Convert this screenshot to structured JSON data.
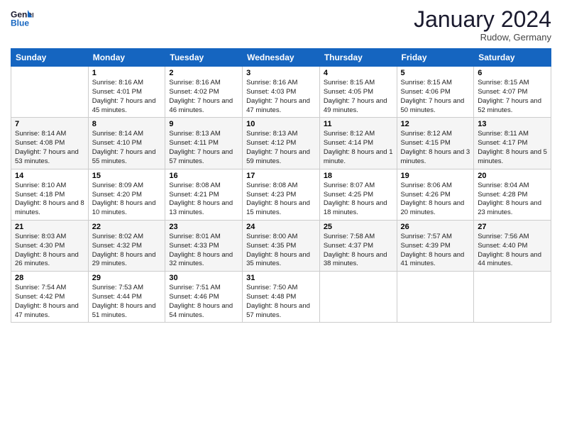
{
  "logo": {
    "line1": "General",
    "line2": "Blue"
  },
  "title": "January 2024",
  "subtitle": "Rudow, Germany",
  "days_header": [
    "Sunday",
    "Monday",
    "Tuesday",
    "Wednesday",
    "Thursday",
    "Friday",
    "Saturday"
  ],
  "weeks": [
    [
      {
        "day": "",
        "sunrise": "",
        "sunset": "",
        "daylight": ""
      },
      {
        "day": "1",
        "sunrise": "Sunrise: 8:16 AM",
        "sunset": "Sunset: 4:01 PM",
        "daylight": "Daylight: 7 hours and 45 minutes."
      },
      {
        "day": "2",
        "sunrise": "Sunrise: 8:16 AM",
        "sunset": "Sunset: 4:02 PM",
        "daylight": "Daylight: 7 hours and 46 minutes."
      },
      {
        "day": "3",
        "sunrise": "Sunrise: 8:16 AM",
        "sunset": "Sunset: 4:03 PM",
        "daylight": "Daylight: 7 hours and 47 minutes."
      },
      {
        "day": "4",
        "sunrise": "Sunrise: 8:15 AM",
        "sunset": "Sunset: 4:05 PM",
        "daylight": "Daylight: 7 hours and 49 minutes."
      },
      {
        "day": "5",
        "sunrise": "Sunrise: 8:15 AM",
        "sunset": "Sunset: 4:06 PM",
        "daylight": "Daylight: 7 hours and 50 minutes."
      },
      {
        "day": "6",
        "sunrise": "Sunrise: 8:15 AM",
        "sunset": "Sunset: 4:07 PM",
        "daylight": "Daylight: 7 hours and 52 minutes."
      }
    ],
    [
      {
        "day": "7",
        "sunrise": "Sunrise: 8:14 AM",
        "sunset": "Sunset: 4:08 PM",
        "daylight": "Daylight: 7 hours and 53 minutes."
      },
      {
        "day": "8",
        "sunrise": "Sunrise: 8:14 AM",
        "sunset": "Sunset: 4:10 PM",
        "daylight": "Daylight: 7 hours and 55 minutes."
      },
      {
        "day": "9",
        "sunrise": "Sunrise: 8:13 AM",
        "sunset": "Sunset: 4:11 PM",
        "daylight": "Daylight: 7 hours and 57 minutes."
      },
      {
        "day": "10",
        "sunrise": "Sunrise: 8:13 AM",
        "sunset": "Sunset: 4:12 PM",
        "daylight": "Daylight: 7 hours and 59 minutes."
      },
      {
        "day": "11",
        "sunrise": "Sunrise: 8:12 AM",
        "sunset": "Sunset: 4:14 PM",
        "daylight": "Daylight: 8 hours and 1 minute."
      },
      {
        "day": "12",
        "sunrise": "Sunrise: 8:12 AM",
        "sunset": "Sunset: 4:15 PM",
        "daylight": "Daylight: 8 hours and 3 minutes."
      },
      {
        "day": "13",
        "sunrise": "Sunrise: 8:11 AM",
        "sunset": "Sunset: 4:17 PM",
        "daylight": "Daylight: 8 hours and 5 minutes."
      }
    ],
    [
      {
        "day": "14",
        "sunrise": "Sunrise: 8:10 AM",
        "sunset": "Sunset: 4:18 PM",
        "daylight": "Daylight: 8 hours and 8 minutes."
      },
      {
        "day": "15",
        "sunrise": "Sunrise: 8:09 AM",
        "sunset": "Sunset: 4:20 PM",
        "daylight": "Daylight: 8 hours and 10 minutes."
      },
      {
        "day": "16",
        "sunrise": "Sunrise: 8:08 AM",
        "sunset": "Sunset: 4:21 PM",
        "daylight": "Daylight: 8 hours and 13 minutes."
      },
      {
        "day": "17",
        "sunrise": "Sunrise: 8:08 AM",
        "sunset": "Sunset: 4:23 PM",
        "daylight": "Daylight: 8 hours and 15 minutes."
      },
      {
        "day": "18",
        "sunrise": "Sunrise: 8:07 AM",
        "sunset": "Sunset: 4:25 PM",
        "daylight": "Daylight: 8 hours and 18 minutes."
      },
      {
        "day": "19",
        "sunrise": "Sunrise: 8:06 AM",
        "sunset": "Sunset: 4:26 PM",
        "daylight": "Daylight: 8 hours and 20 minutes."
      },
      {
        "day": "20",
        "sunrise": "Sunrise: 8:04 AM",
        "sunset": "Sunset: 4:28 PM",
        "daylight": "Daylight: 8 hours and 23 minutes."
      }
    ],
    [
      {
        "day": "21",
        "sunrise": "Sunrise: 8:03 AM",
        "sunset": "Sunset: 4:30 PM",
        "daylight": "Daylight: 8 hours and 26 minutes."
      },
      {
        "day": "22",
        "sunrise": "Sunrise: 8:02 AM",
        "sunset": "Sunset: 4:32 PM",
        "daylight": "Daylight: 8 hours and 29 minutes."
      },
      {
        "day": "23",
        "sunrise": "Sunrise: 8:01 AM",
        "sunset": "Sunset: 4:33 PM",
        "daylight": "Daylight: 8 hours and 32 minutes."
      },
      {
        "day": "24",
        "sunrise": "Sunrise: 8:00 AM",
        "sunset": "Sunset: 4:35 PM",
        "daylight": "Daylight: 8 hours and 35 minutes."
      },
      {
        "day": "25",
        "sunrise": "Sunrise: 7:58 AM",
        "sunset": "Sunset: 4:37 PM",
        "daylight": "Daylight: 8 hours and 38 minutes."
      },
      {
        "day": "26",
        "sunrise": "Sunrise: 7:57 AM",
        "sunset": "Sunset: 4:39 PM",
        "daylight": "Daylight: 8 hours and 41 minutes."
      },
      {
        "day": "27",
        "sunrise": "Sunrise: 7:56 AM",
        "sunset": "Sunset: 4:40 PM",
        "daylight": "Daylight: 8 hours and 44 minutes."
      }
    ],
    [
      {
        "day": "28",
        "sunrise": "Sunrise: 7:54 AM",
        "sunset": "Sunset: 4:42 PM",
        "daylight": "Daylight: 8 hours and 47 minutes."
      },
      {
        "day": "29",
        "sunrise": "Sunrise: 7:53 AM",
        "sunset": "Sunset: 4:44 PM",
        "daylight": "Daylight: 8 hours and 51 minutes."
      },
      {
        "day": "30",
        "sunrise": "Sunrise: 7:51 AM",
        "sunset": "Sunset: 4:46 PM",
        "daylight": "Daylight: 8 hours and 54 minutes."
      },
      {
        "day": "31",
        "sunrise": "Sunrise: 7:50 AM",
        "sunset": "Sunset: 4:48 PM",
        "daylight": "Daylight: 8 hours and 57 minutes."
      },
      {
        "day": "",
        "sunrise": "",
        "sunset": "",
        "daylight": ""
      },
      {
        "day": "",
        "sunrise": "",
        "sunset": "",
        "daylight": ""
      },
      {
        "day": "",
        "sunrise": "",
        "sunset": "",
        "daylight": ""
      }
    ]
  ]
}
